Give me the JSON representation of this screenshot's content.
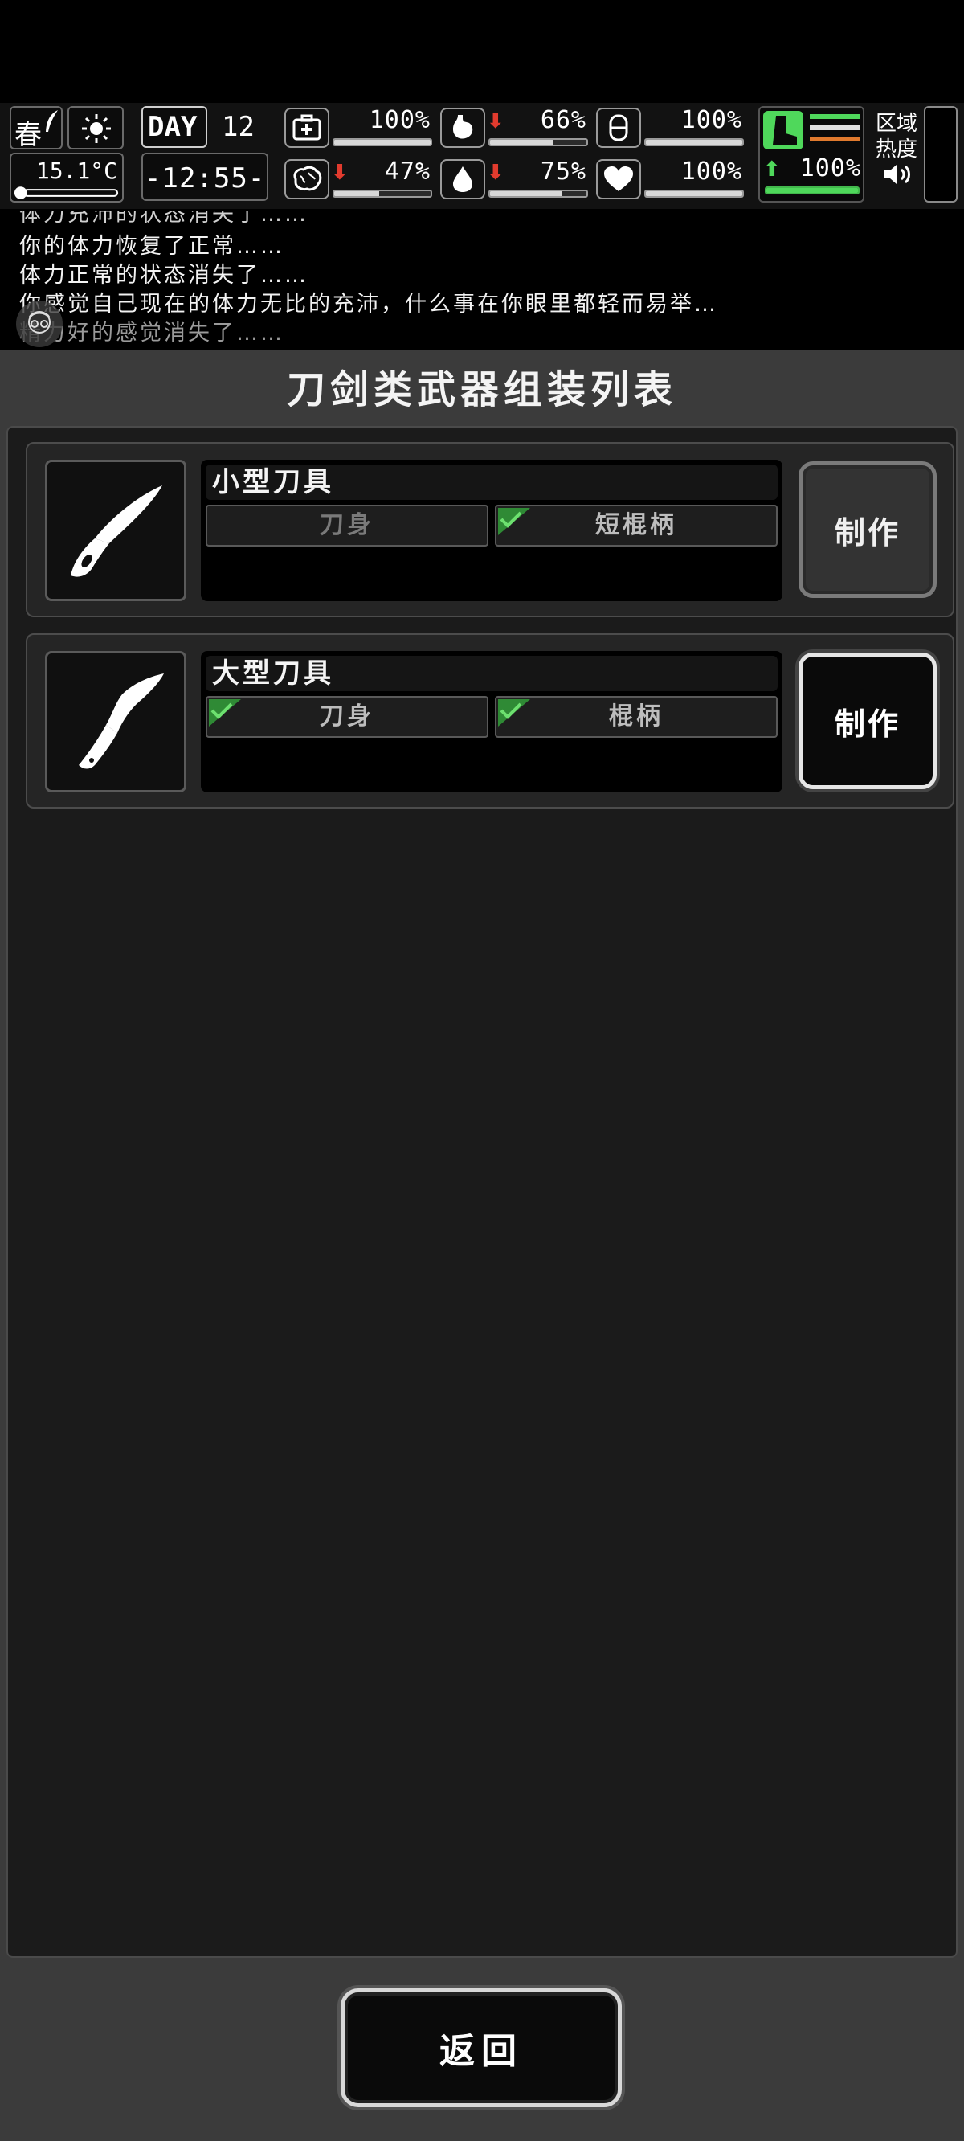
{
  "status": {
    "season": "春",
    "day_label": "DAY",
    "day_number": "12",
    "temperature": "15.1°C",
    "time": "-12:55-",
    "health_pct": "100%",
    "hunger_pct": "66%",
    "armor_pct": "100%",
    "mind_pct": "47%",
    "thirst_pct": "75%",
    "mood_pct": "100%",
    "stamina_pct": "100%",
    "area_heat_label": [
      "区域",
      "热度"
    ],
    "levels": {
      "health": 100,
      "hunger": 66,
      "armor": 100,
      "mind": 47,
      "thirst": 75,
      "mood": 100,
      "stamina": 100
    },
    "colors": {
      "down_arrow": "#e23b2e",
      "up_arrow": "#4fd85b",
      "stamina_green": "#4fd85b"
    }
  },
  "log": [
    "体力充沛的状态消失了……",
    "你的体力恢复了正常……",
    "体力正常的状态消失了……",
    "你感觉自己现在的体力无比的充沛，什么事在你眼里都轻而易举…",
    "精力好的感觉消失了……"
  ],
  "panel": {
    "title": "刀剑类武器组装列表",
    "recipes": [
      {
        "name": "小型刀具",
        "icon": "folding-knife-icon",
        "parts": [
          {
            "label": "刀身",
            "have": false
          },
          {
            "label": "短棍柄",
            "have": true
          }
        ],
        "action": "制作",
        "enabled": false
      },
      {
        "name": "大型刀具",
        "icon": "kukri-icon",
        "parts": [
          {
            "label": "刀身",
            "have": true
          },
          {
            "label": "棍柄",
            "have": true
          }
        ],
        "action": "制作",
        "enabled": true
      }
    ],
    "back": "返回"
  }
}
